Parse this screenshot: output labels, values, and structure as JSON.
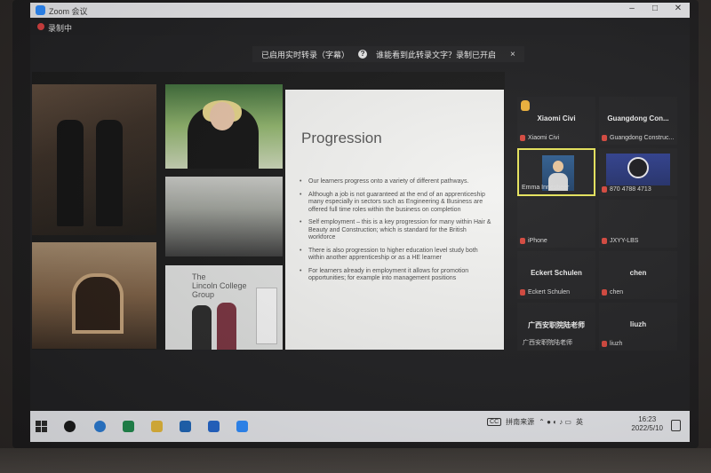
{
  "window": {
    "title": "Zoom 会议",
    "controls": [
      "–",
      "□",
      "✕"
    ]
  },
  "recording": {
    "label": "录制中"
  },
  "banner": {
    "text1": "已启用实时转录（字幕）",
    "text2": "谁能看到此转录文字？录制已开启",
    "close": "×",
    "q_icon": "?"
  },
  "slide": {
    "title": "Progression",
    "brand_line1": "The",
    "brand_line2": "Lincoln College",
    "brand_line3": "Group",
    "bullets": [
      "Our learners progress onto a variety of different pathways.",
      "Although a job is not guaranteed at the end of an apprenticeship many especially in sectors such as Engineering & Business are offered full time roles within the business on completion",
      "Self employment – this is a key progression for many within Hair & Beauty and Construction; which is standard for the British workforce",
      "There is also progression to higher education level study both within another apprenticeship or as a HE learner",
      "For learners already in employment it allows for promotion opportunities; for example into management positions"
    ]
  },
  "participants": [
    {
      "display": "Xiaomi Civi",
      "name": "Xiaomi Civi",
      "hand_icon": "raised-hand-icon"
    },
    {
      "display": "Guangdong Con...",
      "name": "Guangdong Construc..."
    },
    {
      "display": "",
      "name": "Emma Innesbeer"
    },
    {
      "display": "",
      "name": "870 4788 4713"
    },
    {
      "display": "",
      "name": "iPhone"
    },
    {
      "display": "",
      "name": "JXYY-LBS"
    },
    {
      "display": "Eckert Schulen",
      "name": "Eckert Schulen"
    },
    {
      "display": "chen",
      "name": "chen"
    },
    {
      "display": "广西安职院陆老师",
      "name": "广西安职院陆老师"
    },
    {
      "display": "liuzh",
      "name": "liuzh"
    }
  ],
  "taskbar": {
    "tray_ime": "英",
    "tray_caption": "拼南来源",
    "cc": "CC",
    "time": "16:23",
    "date": "2022/5/10"
  },
  "colors": {
    "accent_zoom": "#2d8cff",
    "active_speaker": "#e6e35a",
    "muted_red": "#d6473d"
  }
}
